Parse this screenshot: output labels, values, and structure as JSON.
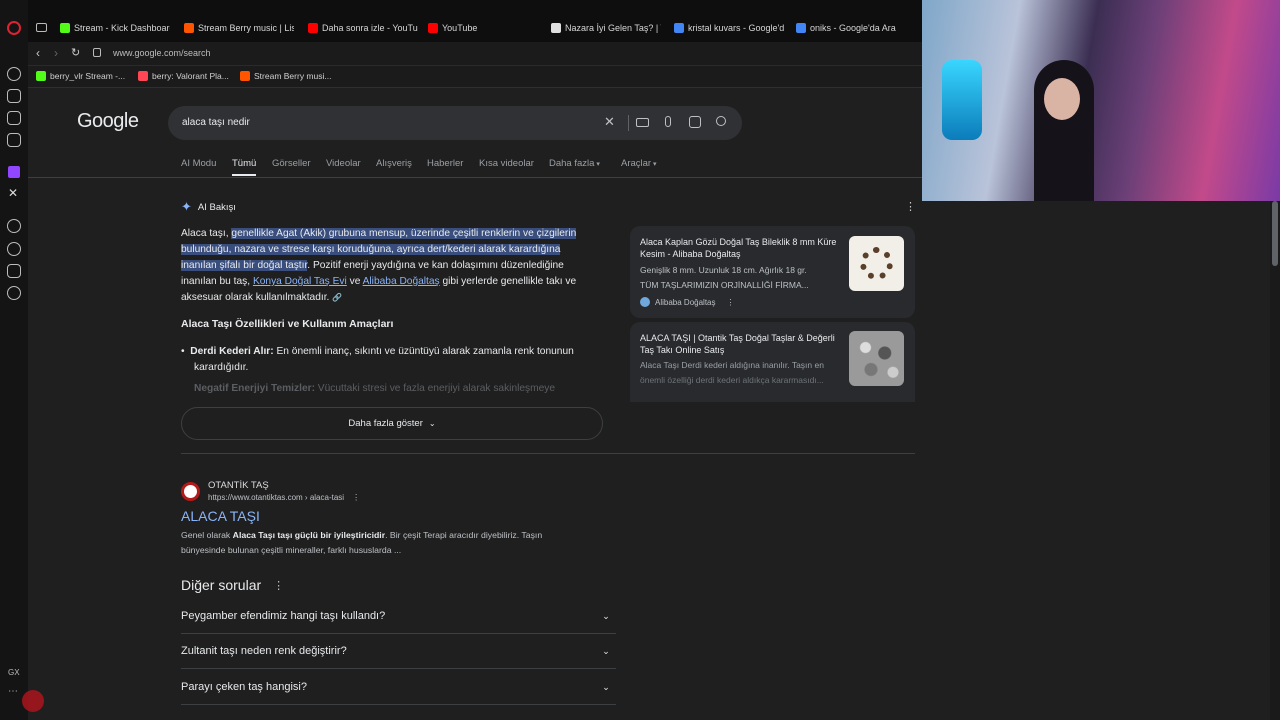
{
  "tabs": [
    {
      "label": "Stream - Kick Dashboard",
      "color": "#53fc18"
    },
    {
      "label": "Stream Berry music | Lis",
      "color": "#ff5500"
    },
    {
      "label": "Daha sonra izle - YouTub",
      "color": "#ff0000"
    },
    {
      "label": "YouTube",
      "color": "#ff0000"
    },
    {
      "label": "Nazara İyi Gelen Taş? | T",
      "color": "#e0e0e0"
    },
    {
      "label": "kristal kuvars - Google'd",
      "color": "#4285f4"
    },
    {
      "label": "oniks - Google'da Ara",
      "color": "#4285f4"
    }
  ],
  "address": {
    "url": "www.google.com/search"
  },
  "bookmarks": [
    {
      "label": "berry_vlr Stream -...",
      "color": "#53fc18"
    },
    {
      "label": "berry: Valorant Pla...",
      "color": "#ff4655"
    },
    {
      "label": "Stream Berry musi...",
      "color": "#ff5500"
    }
  ],
  "google": {
    "logo": "Google",
    "query": "alaca taşı nedir",
    "nav_tabs": [
      "AI Modu",
      "Tümü",
      "Görseller",
      "Videolar",
      "Alışveriş",
      "Haberler",
      "Kısa videolar",
      "Daha fazla",
      "Araçlar"
    ]
  },
  "ai_overview": {
    "title": "AI Bakışı",
    "p_intro": "Alaca taşı, ",
    "p_highlight_1": "genellikle Agat (Akik) grubuna mensup, üzerinde çeşitli renklerin ve çizgilerin",
    "p_highlight_2": "bulunduğu, nazara ve strese karşı koruduğuna, ayrıca dert/kederi alarak karardığına",
    "p_highlight_3": "inanılan şifalı bir doğal taştır",
    "p_rest_1": ". Pozitif enerji yaydığına ve kan dolaşımını düzenlediğine",
    "p_rest_2": "inanılan bu taş, ",
    "link_1": "Konya Doğal Taş Evi",
    "p_and": " ve ",
    "link_2": "Alibaba Doğaltaş",
    "p_rest_3": " gibi yerlerde genellikle takı ve",
    "p_rest_4": "aksesuar olarak kullanılmaktadır.",
    "heading": "Alaca Taşı Özellikleri ve Kullanım Amaçları",
    "bullet_1_bold": "Derdi Kederi Alır:",
    "bullet_1_text": " En önemli inanç, sıkıntı ve üzüntüyü alarak zamanla renk tonunun",
    "bullet_1_text2": "karardığıdır.",
    "bullet_2_bold": "Negatif Enerjiyi Temizler:",
    "bullet_2_text": " Vücuttaki stresi ve fazla enerjiyi alarak sakinleşmeye",
    "show_more": "Daha fazla göster"
  },
  "side_cards": [
    {
      "title": "Alaca Kaplan Gözü Doğal Taş Bileklik 8 mm Küre Kesim - Alibaba Doğaltaş",
      "desc1": "Genişlik 8 mm. Uzunluk 18 cm. Ağırlık 18 gr.",
      "desc2": "TÜM TAŞLARIMIZIN ORJİNALLİĞİ FİRMA...",
      "source": "Alibaba Doğaltaş"
    },
    {
      "title": "ALACA TAŞI | Otantik Taş Doğal Taşlar & Değerli Taş Takı Online Satış",
      "desc1": "Alaca Taşı Derdi kederi aldığına inanılır. Taşın en",
      "desc2": "önemli özelliği derdi kederi aldıkça kararmasıdı..."
    }
  ],
  "result": {
    "site": "OTANTİK TAŞ",
    "url": "https://www.otantiktas.com › alaca-tasi",
    "title": "ALACA TAŞI",
    "snippet_1_a": "Genel olarak ",
    "snippet_1_b": "Alaca Taşı taşı güçlü bir iyileştiricidir",
    "snippet_1_c": ". Bir çeşit Terapi aracıdır diyebiliriz. Taşın",
    "snippet_2": "bünyesinde bulunan çeşitli mineraller, farklı hususlarda ..."
  },
  "paa": {
    "title": "Diğer sorular",
    "questions": [
      "Peygamber efendimiz hangi taşı kullandı?",
      "Zultanit taşı neden renk değiştirir?",
      "Parayı çeken taş hangisi?"
    ]
  },
  "sidebar_bottom": {
    "gx": "GX"
  }
}
